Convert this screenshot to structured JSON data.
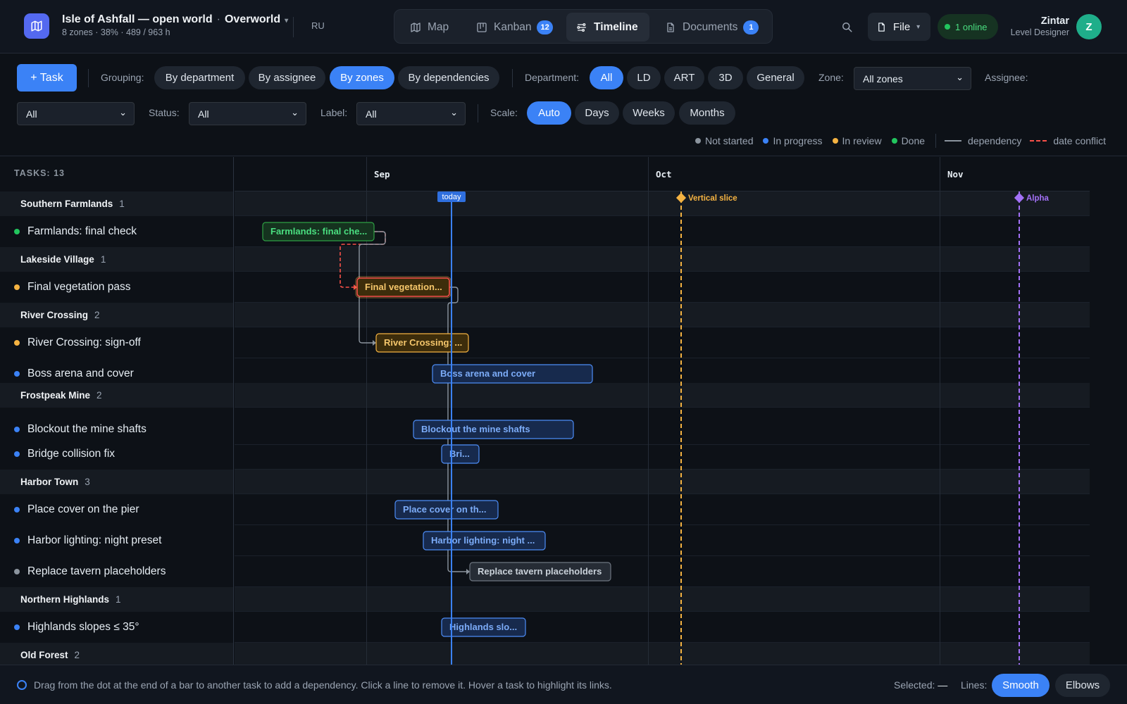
{
  "header": {
    "project": "Isle of Ashfall — open world",
    "separator": "·",
    "map_name": "Overworld",
    "subtitle": "8 zones · 38% · 489 / 963 h",
    "language": "RU",
    "nav_tabs": [
      {
        "label": "Map",
        "icon": "map-icon"
      },
      {
        "label": "Kanban",
        "icon": "kanban-icon",
        "badge": "12"
      },
      {
        "label": "Timeline",
        "icon": "timeline-icon",
        "active": true
      },
      {
        "label": "Documents",
        "icon": "document-icon",
        "badge": "1"
      }
    ],
    "file_label": "File",
    "online_label": "1 online",
    "user_name": "Zintar",
    "user_role": "Level Designer",
    "avatar_letter": "Z"
  },
  "toolbar": {
    "task_button": "+ Task",
    "grouping_label": "Grouping:",
    "grouping_options": [
      "By department",
      "By assignee",
      "By zones",
      "By dependencies"
    ],
    "grouping_selected": "By zones",
    "department_label": "Department:",
    "department_options": [
      "All",
      "LD",
      "ART",
      "3D",
      "General"
    ],
    "department_selected": "All",
    "zone_label": "Zone:",
    "zone_value": "All zones",
    "assignee_label": "Assignee:",
    "assignee_value": "All",
    "status_label": "Status:",
    "status_value": "All",
    "label_label": "Label:",
    "label_value": "All",
    "scale_label": "Scale:",
    "scale_options": [
      "Auto",
      "Days",
      "Weeks",
      "Months"
    ],
    "scale_selected": "Auto"
  },
  "legend": {
    "items": [
      {
        "label": "Not started",
        "color": "#8b949e"
      },
      {
        "label": "In progress",
        "color": "#3b82f6"
      },
      {
        "label": "In review",
        "color": "#f5b342"
      },
      {
        "label": "Done",
        "color": "#22c55e"
      }
    ],
    "dependency_label": "dependency",
    "conflict_label": "date conflict"
  },
  "sidebar": {
    "task_count": "TASKS: 13",
    "rows": [
      {
        "type": "group",
        "label": "Southern Farmlands",
        "count": "1"
      },
      {
        "type": "task",
        "label": "Farmlands: final check",
        "status": "done"
      },
      {
        "type": "group",
        "label": "Lakeside Village",
        "count": "1"
      },
      {
        "type": "task",
        "label": "Final vegetation pass",
        "status": "review"
      },
      {
        "type": "group",
        "label": "River Crossing",
        "count": "2"
      },
      {
        "type": "task",
        "label": "River Crossing: sign-off",
        "status": "review"
      },
      {
        "type": "task",
        "label": "Boss arena and cover",
        "status": "progress"
      },
      {
        "type": "group",
        "label": "Frostpeak Mine",
        "count": "2"
      },
      {
        "type": "task",
        "label": "Blockout the mine shafts",
        "status": "progress"
      },
      {
        "type": "task",
        "label": "Bridge collision fix",
        "status": "progress"
      },
      {
        "type": "group",
        "label": "Harbor Town",
        "count": "3"
      },
      {
        "type": "task",
        "label": "Place cover on the pier",
        "status": "progress"
      },
      {
        "type": "task",
        "label": "Harbor lighting: night preset",
        "status": "progress"
      },
      {
        "type": "task",
        "label": "Replace tavern placeholders",
        "status": "not_started"
      },
      {
        "type": "group",
        "label": "Northern Highlands",
        "count": "1"
      },
      {
        "type": "task",
        "label": "Highlands slopes ≤ 35°",
        "status": "progress"
      },
      {
        "type": "group",
        "label": "Old Forest",
        "count": "2"
      }
    ]
  },
  "timeline": {
    "months": [
      "Sep",
      "Oct",
      "Nov"
    ],
    "today_label": "today",
    "milestones": [
      {
        "label": "Vertical slice",
        "color": "#f5b342"
      },
      {
        "label": "Alpha",
        "color": "#a371f7"
      }
    ],
    "bars": [
      {
        "label": "Farmlands: final che...",
        "status": "done"
      },
      {
        "label": "Final vegetation...",
        "status": "review",
        "highlight": true
      },
      {
        "label": "River Crossing: ...",
        "status": "review"
      },
      {
        "label": "Boss arena and cover",
        "status": "progress"
      },
      {
        "label": "Blockout the mine shafts",
        "status": "progress"
      },
      {
        "label": "Bri...",
        "status": "progress"
      },
      {
        "label": "Place cover on th...",
        "status": "progress"
      },
      {
        "label": "Harbor lighting: night ...",
        "status": "progress"
      },
      {
        "label": "Replace tavern placeholders",
        "status": "not_started"
      },
      {
        "label": "Highlands slo...",
        "status": "progress"
      }
    ]
  },
  "footer": {
    "hint": "Drag from the dot at the end of a bar to another task to add a dependency. Click a line to remove it. Hover a task to highlight its links.",
    "selected_label": "Selected:",
    "selected_value": "—",
    "lines_label": "Lines:",
    "line_options": [
      "Smooth",
      "Elbows"
    ],
    "line_selected": "Smooth"
  },
  "colors": {
    "accent": "#3b82f6",
    "done": "#22c55e",
    "review": "#f5b342",
    "progress": "#3b82f6",
    "not_started": "#8b949e",
    "conflict": "#f85149",
    "milestone_1": "#f5b342",
    "milestone_2": "#a371f7"
  }
}
